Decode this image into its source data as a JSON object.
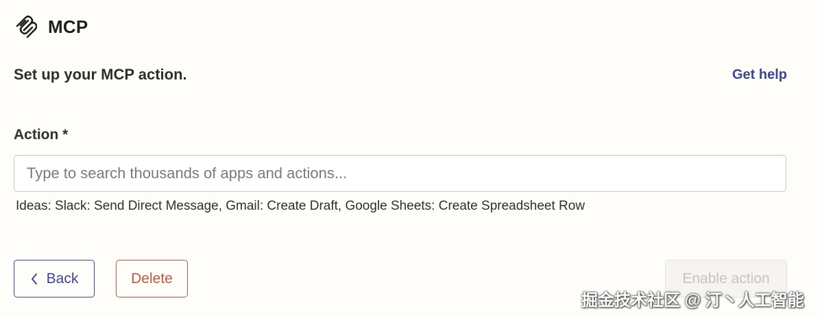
{
  "header": {
    "logo_icon": "mcp-logo-icon",
    "title": "MCP"
  },
  "setup": {
    "title": "Set up your MCP action.",
    "help_link": "Get help"
  },
  "action_field": {
    "label": "Action *",
    "value": "",
    "placeholder": "Type to search thousands of apps and actions...",
    "ideas": "Ideas: Slack: Send Direct Message, Gmail: Create Draft, Google Sheets: Create Spreadsheet Row"
  },
  "footer": {
    "back_icon": "chevron-left-icon",
    "back_label": "Back",
    "delete_label": "Delete",
    "enable_label": "Enable action"
  },
  "watermark": "掘金技术社区 @ 汀丶人工智能",
  "colors": {
    "background": "#fffdf9",
    "accent": "#3d4592",
    "danger": "#c0573e",
    "disabled_text": "#c6c4c0"
  }
}
